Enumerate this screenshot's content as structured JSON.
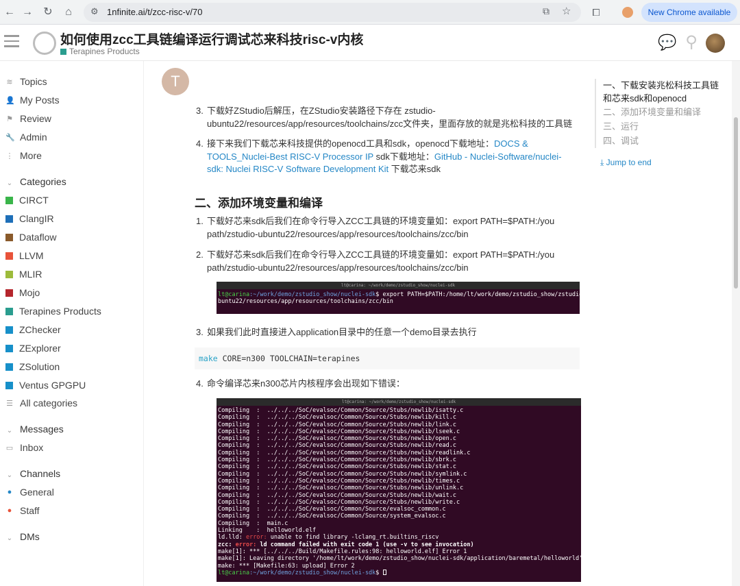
{
  "browser": {
    "url": "1nfinite.ai/t/zcc-risc-v/70",
    "new_chrome": "New Chrome available"
  },
  "header": {
    "title": "如何使用zcc工具链编译运行调试芯来科技risc-v内核",
    "category": "Terapines Products",
    "category_color": "#2a9d8f"
  },
  "sidebar": {
    "nav": [
      {
        "label": "Topics",
        "icon": "layers-icon"
      },
      {
        "label": "My Posts",
        "icon": "user-icon"
      },
      {
        "label": "Review",
        "icon": "flag-icon"
      },
      {
        "label": "Admin",
        "icon": "wrench-icon"
      },
      {
        "label": "More",
        "icon": "ellipsis-icon"
      }
    ],
    "categories_heading": "Categories",
    "categories": [
      {
        "label": "CIRCT",
        "color": "#3ab54a"
      },
      {
        "label": "ClangIR",
        "color": "#1e6fb8"
      },
      {
        "label": "Dataflow",
        "color": "#8a5a2b"
      },
      {
        "label": "LLVM",
        "color": "#e8533a"
      },
      {
        "label": "MLIR",
        "color": "#9dbb3b"
      },
      {
        "label": "Mojo",
        "color": "#b5262d"
      },
      {
        "label": "Terapines Products",
        "color": "#2a9d8f"
      },
      {
        "label": "ZChecker",
        "color": "#1790c9"
      },
      {
        "label": "ZExplorer",
        "color": "#1790c9"
      },
      {
        "label": "ZSolution",
        "color": "#1790c9"
      },
      {
        "label": "Ventus GPGPU",
        "color": "#1790c9"
      }
    ],
    "all_categories": "All categories",
    "messages_heading": "Messages",
    "inbox": "Inbox",
    "channels_heading": "Channels",
    "channels": [
      {
        "label": "General",
        "color": "#2487c6"
      },
      {
        "label": "Staff",
        "color": "#e8533a"
      }
    ],
    "dms_heading": "DMs"
  },
  "post": {
    "avatar_letter": "T",
    "item3a_num": "3.",
    "item3a_line1": "下载好ZStudio后解压，在ZStudio安装路径下存在 zstudio-",
    "item3a_line2": "ubuntu22/resources/app/resources/toolchains/zcc文件夹，里面存放的就是兆松科技的工具链",
    "item4a_num": "4.",
    "item4a_text1": "接下来我们下载芯来科技提供的openocd工具和sdk，openocd下载地址：",
    "item4a_link1a": "DOCS &",
    "item4a_link1b": "TOOLS_Nuclei-Best RISC-V Processor IP",
    "item4a_text2": " sdk下载地址：",
    "item4a_link2a": "GitHub - Nuclei-Software/nuclei-",
    "item4a_link2b": "sdk: Nuclei RISC-V Software Development Kit",
    "item4a_text3": " 下载芯来sdk",
    "section2_heading": "二、添加环境变量和编译",
    "item1_num": "1.",
    "item1_line1": "下载好芯来sdk后我们在命令行导入ZCC工具链的环境变量如：export PATH=$PATH:/you",
    "item1_line2": "path/zstudio-ubuntu22/resources/app/resources/toolchains/zcc/bin",
    "item2_num": "2.",
    "item2_line1": "下载好芯来sdk后我们在命令行导入ZCC工具链的环境变量如：export PATH=$PATH:/you",
    "item2_line2": "path/zstudio-ubuntu22/resources/app/resources/toolchains/zcc/bin",
    "term1_title": "lt@carina: ~/work/demo/zstudio_show/nuclei-sdk",
    "term1_prompt_user": "lt@carina",
    "term1_prompt_path": ":~/work/demo/zstudio_show/nuclei-sdk",
    "term1_cmd": "$ export PATH=$PATH:/home/lt/work/demo/zstudio_show/zstudio-u",
    "term1_cmd2": "buntu22/resources/app/resources/toolchains/zcc/bin",
    "item3b_num": "3.",
    "item3b_text": "如果我们此时直接进入application目录中的任意一个demo目录去执行",
    "code_kw": "make",
    "code_rest": " CORE=n300 TOOLCHAIN=terapines",
    "item4b_num": "4.",
    "item4b_text": "命令编译芯来n300芯片内核程序会出现如下错误：",
    "term2_title": "lt@carina: ~/work/demo/zstudio_show/nuclei-sdk",
    "term2_compiling": [
      "../../../SoC/evalsoc/Common/Source/Stubs/newlib/isatty.c",
      "../../../SoC/evalsoc/Common/Source/Stubs/newlib/kill.c",
      "../../../SoC/evalsoc/Common/Source/Stubs/newlib/link.c",
      "../../../SoC/evalsoc/Common/Source/Stubs/newlib/lseek.c",
      "../../../SoC/evalsoc/Common/Source/Stubs/newlib/open.c",
      "../../../SoC/evalsoc/Common/Source/Stubs/newlib/read.c",
      "../../../SoC/evalsoc/Common/Source/Stubs/newlib/readlink.c",
      "../../../SoC/evalsoc/Common/Source/Stubs/newlib/sbrk.c",
      "../../../SoC/evalsoc/Common/Source/Stubs/newlib/stat.c",
      "../../../SoC/evalsoc/Common/Source/Stubs/newlib/symlink.c",
      "../../../SoC/evalsoc/Common/Source/Stubs/newlib/times.c",
      "../../../SoC/evalsoc/Common/Source/Stubs/newlib/unlink.c",
      "../../../SoC/evalsoc/Common/Source/Stubs/newlib/wait.c",
      "../../../SoC/evalsoc/Common/Source/Stubs/newlib/write.c",
      "../../../SoC/evalsoc/Common/Source/evalsoc_common.c",
      "../../../SoC/evalsoc/Common/Source/system_evalsoc.c",
      "main.c"
    ],
    "term2_compiling_label": "Compiling  :  ",
    "term2_linking": "Linking    :  helloworld.elf",
    "term2_ld_prefix": "ld.lld: ",
    "term2_ld_error": "error: ",
    "term2_ld_msg": "unable to find library -lclang_rt.builtins_riscv",
    "term2_zcc_prefix": "zcc: ",
    "term2_zcc_error": "error: ",
    "term2_zcc_msg": "ld command failed with exit code 1 (use -v to see invocation)",
    "term2_make1": "make[1]: *** [../../../Build/Makefile.rules:98: helloworld.elf] Error 1",
    "term2_make2": "make[1]: Leaving directory '/home/lt/work/demo/zstudio_show/nuclei-sdk/application/baremetal/helloworld'",
    "term2_make3": "make: *** [Makefile:63: upload] Error 2",
    "term2_prompt_user": "lt@carina",
    "term2_prompt_path": ":~/work/demo/zstudio_show/nuclei-sdk",
    "term2_prompt_end": "$ "
  },
  "toc": {
    "items": [
      {
        "label": "一、下载安装兆松科技工具链和芯来sdk和openocd",
        "active": true
      },
      {
        "label": "二、添加环境变量和编译",
        "active": false
      },
      {
        "label": "三、运行",
        "active": false
      },
      {
        "label": "四、调试",
        "active": false
      }
    ],
    "jump": "Jump to end"
  }
}
